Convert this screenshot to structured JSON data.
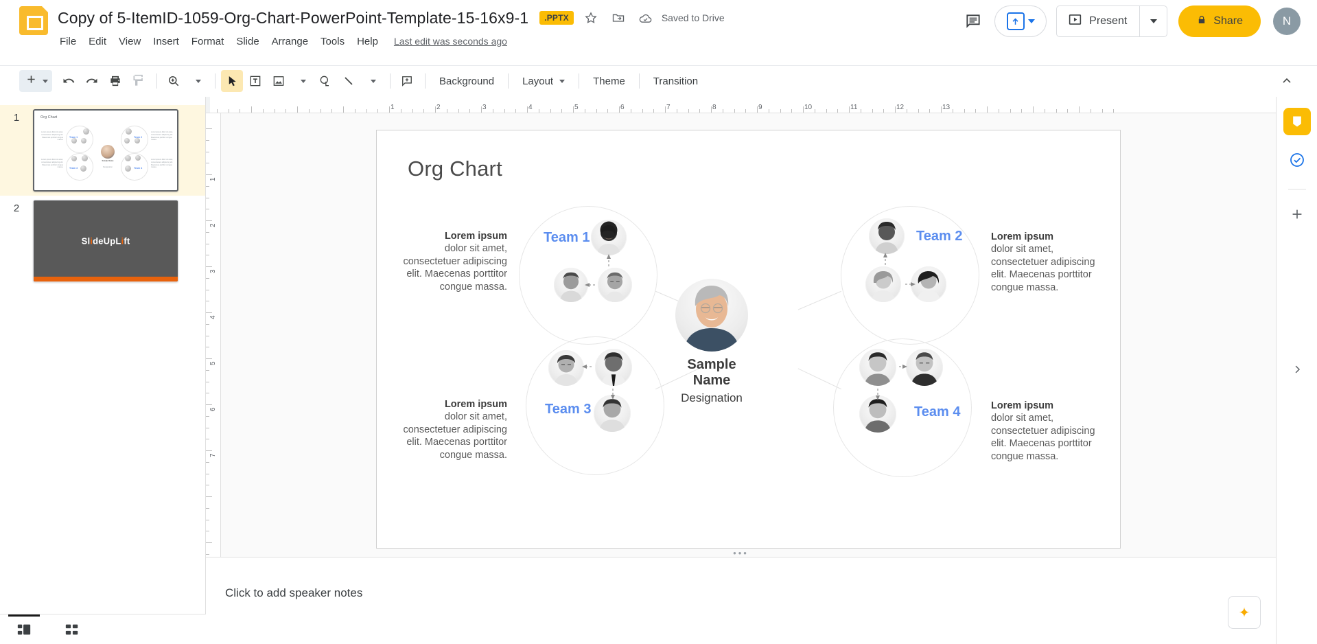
{
  "app": {
    "logo_icon": "slides-logo-icon"
  },
  "header": {
    "doc_title": "Copy of 5-ItemID-1059-Org-Chart-PowerPoint-Template-15-16x9-1",
    "file_badge": ".PPTX",
    "star_icon": "star-icon",
    "move_icon": "move-to-folder-icon",
    "cloud_icon": "cloud-saved-icon",
    "save_status": "Saved to Drive",
    "menus": [
      "File",
      "Edit",
      "View",
      "Insert",
      "Format",
      "Slide",
      "Arrange",
      "Tools",
      "Help"
    ],
    "last_edit": "Last edit was seconds ago",
    "comment_icon": "comment-history-icon",
    "meet_icon": "present-to-meeting-icon",
    "present_label": "Present",
    "present_icon": "present-screen-icon",
    "present_caret_icon": "chevron-down-icon",
    "share_label": "Share",
    "share_icon": "lock-icon",
    "avatar_initial": "N"
  },
  "toolbar": {
    "new_slide_icon": "plus-icon",
    "new_slide_caret_icon": "chevron-down-icon",
    "undo_icon": "undo-icon",
    "redo_icon": "redo-icon",
    "print_icon": "print-icon",
    "paint_format_icon": "paint-format-icon",
    "zoom_icon": "zoom-icon",
    "zoom_caret_icon": "chevron-down-icon",
    "select_icon": "select-cursor-icon",
    "textbox_icon": "text-box-icon",
    "image_icon": "insert-image-icon",
    "image_caret_icon": "chevron-down-icon",
    "shape_icon": "insert-shape-icon",
    "line_icon": "insert-line-icon",
    "line_caret_icon": "chevron-down-icon",
    "comment_icon": "add-comment-icon",
    "background_label": "Background",
    "layout_label": "Layout",
    "layout_caret_icon": "chevron-down-icon",
    "theme_label": "Theme",
    "transition_label": "Transition",
    "collapse_icon": "chevron-up-icon"
  },
  "filmstrip": {
    "slides": [
      {
        "number": "1",
        "title": "Org Chart",
        "selected": true
      },
      {
        "number": "2",
        "title": "SlideUpLift",
        "selected": false
      }
    ],
    "brand_text": "SlideUpLift"
  },
  "ruler": {
    "h_labels": [
      "1",
      "2",
      "3",
      "4",
      "5",
      "6",
      "7",
      "8",
      "9",
      "10",
      "11",
      "12",
      "13"
    ],
    "v_labels": [
      "1",
      "2",
      "3",
      "4",
      "5",
      "6",
      "7"
    ]
  },
  "slide": {
    "title": "Org Chart",
    "center": {
      "name": "Sample\nName",
      "name_line1": "Sample",
      "name_line2": "Name",
      "designation": "Designation"
    },
    "teams": [
      {
        "id": "team1",
        "label": "Team 1"
      },
      {
        "id": "team2",
        "label": "Team 2"
      },
      {
        "id": "team3",
        "label": "Team 3"
      },
      {
        "id": "team4",
        "label": "Team 4"
      }
    ],
    "blurbs": [
      {
        "id": "blurb-team1",
        "bold": "Lorem ipsum",
        "body": "dolor sit amet, consectetuer adipiscing elit. Maecenas porttitor congue massa."
      },
      {
        "id": "blurb-team2",
        "bold": "Lorem ipsum",
        "body": "dolor sit amet, consectetuer adipiscing elit. Maecenas porttitor congue massa."
      },
      {
        "id": "blurb-team3",
        "bold": "Lorem ipsum",
        "body": "dolor sit amet, consectetuer adipiscing elit. Maecenas porttitor congue massa."
      },
      {
        "id": "blurb-team4",
        "bold": "Lorem ipsum",
        "body": "dolor sit amet, consectetuer adipiscing elit. Maecenas porttitor congue massa."
      }
    ]
  },
  "notes": {
    "placeholder": "Click to add speaker notes",
    "expand_icon": "sparkle-expand-icon"
  },
  "rightbar": {
    "keep_icon": "keep-notes-icon",
    "tasks_icon": "tasks-icon",
    "add_icon": "add-apps-icon",
    "expand_icon": "expand-side-panel-icon"
  },
  "viewbar": {
    "filmstrip_icon": "filmstrip-view-icon",
    "grid_icon": "grid-view-icon"
  },
  "colors": {
    "accent_yellow": "#FBBC04",
    "team_blue": "#5B8DEF",
    "brand_orange": "#E8620C",
    "selected_row": "#FEF7E0"
  }
}
